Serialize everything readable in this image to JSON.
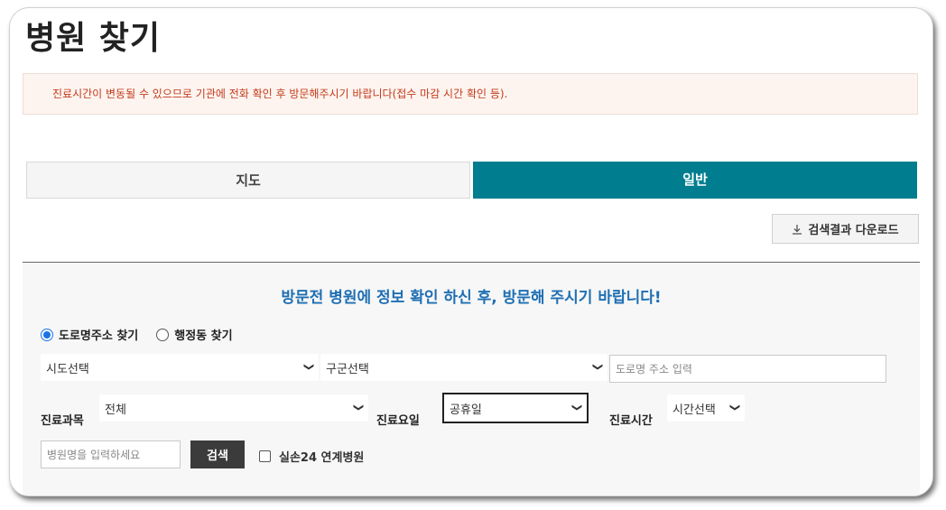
{
  "page": {
    "title": "병원 찾기"
  },
  "notice": {
    "text": "진료시간이 변동될 수 있으므로 기관에 전화 확인 후 방문해주시기 바랍니다(접수 마감 시간 확인 등)."
  },
  "tabs": [
    {
      "label": "지도",
      "active": false
    },
    {
      "label": "일반",
      "active": true
    }
  ],
  "download": {
    "label": "검색결과 다운로드",
    "icon": "download-icon"
  },
  "search": {
    "heading": "방문전 병원에 정보 확인 하신 후, 방문해 주시기 바랍니다!",
    "radios": [
      {
        "label": "도로명주소 찾기",
        "checked": true
      },
      {
        "label": "행정동 찾기",
        "checked": false
      }
    ],
    "sido": "시도선택",
    "gugun": "구군선택",
    "road_placeholder": "도로명 주소 입력",
    "dept_label": "진료과목",
    "dept_value": "전체",
    "day_label": "진료요일",
    "day_value": "공휴일",
    "time_label": "진료시간",
    "time_value": "시간선택",
    "name_placeholder": "병원명을 입력하세요",
    "search_button": "검색",
    "checkbox_label": "실손24 연계병원"
  },
  "colors": {
    "accent": "#007e8f",
    "heading": "#1f6fb3",
    "notice": "#c43b1a"
  }
}
